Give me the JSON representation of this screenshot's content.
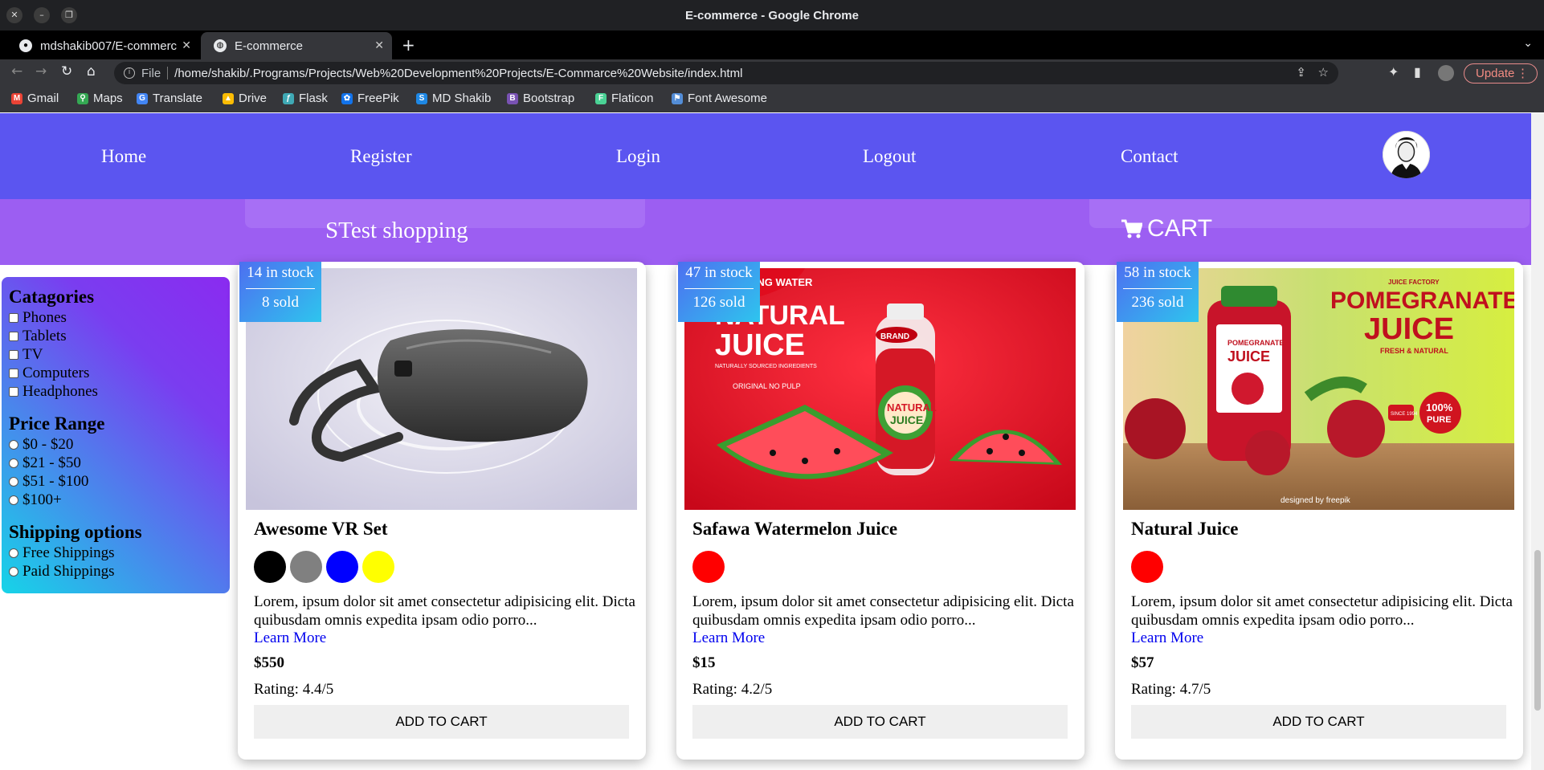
{
  "window": {
    "title": "E-commerce - Google Chrome"
  },
  "tabs": [
    {
      "label": "mdshakib007/E-commerce",
      "icon": "github-icon"
    },
    {
      "label": "E-commerce",
      "icon": "globe-icon"
    }
  ],
  "address": {
    "scheme": "File",
    "url": "/home/shakib/.Programs/Projects/Web%20Development%20Projects/E-Commarce%20Website/index.html"
  },
  "update_label": "Update",
  "bookmarks": [
    {
      "label": "Gmail",
      "icon": "gmail-icon",
      "color": "#ea4335"
    },
    {
      "label": "Maps",
      "icon": "maps-icon",
      "color": "#34a853"
    },
    {
      "label": "Translate",
      "icon": "translate-icon",
      "color": "#4285f4"
    },
    {
      "label": "Drive",
      "icon": "drive-icon",
      "color": "#fbbc04"
    },
    {
      "label": "Flask",
      "icon": "flask-icon",
      "color": "#3fa9b5"
    },
    {
      "label": "FreePik",
      "icon": "freepik-icon",
      "color": "#1273eb"
    },
    {
      "label": "MD Shakib",
      "icon": "site-icon",
      "color": "#1e88e5"
    },
    {
      "label": "Bootstrap",
      "icon": "bootstrap-icon",
      "color": "#7952b3"
    },
    {
      "label": "Flaticon",
      "icon": "flaticon-icon",
      "color": "#4ad295"
    },
    {
      "label": "Font Awesome",
      "icon": "fontawesome-icon",
      "color": "#538dd7"
    }
  ],
  "nav": {
    "home": "Home",
    "register": "Register",
    "login": "Login",
    "logout": "Logout",
    "contact": "Contact"
  },
  "shop": {
    "title": "STest shopping",
    "cart": "CART"
  },
  "filters": {
    "categories_title": "Catagories",
    "categories": [
      "Phones",
      "Tablets",
      "TV",
      "Computers",
      "Headphones"
    ],
    "price_title": "Price Range",
    "prices": [
      "$0 - $20",
      "$21 - $50",
      "$51 - $100",
      "$100+"
    ],
    "shipping_title": "Shipping options",
    "shipping": [
      "Free Shippings",
      "Paid Shippings"
    ]
  },
  "products": [
    {
      "stock": "14 in stock",
      "sold": "8 sold",
      "name": "Awesome VR Set",
      "colors": [
        "#000000",
        "#808080",
        "#0000ff",
        "#ffff00"
      ],
      "desc": "Lorem, ipsum dolor sit amet consectetur adipisicing elit. Dicta quibusdam omnis expedita ipsam odio porro...",
      "learn": "Learn More",
      "price": "$550",
      "rating": "Rating: 4.4/5",
      "button": "ADD TO CART"
    },
    {
      "stock": "47 in stock",
      "sold": "126 sold",
      "name": "Safawa Watermelon Juice",
      "colors": [
        "#ff0000"
      ],
      "desc": "Lorem, ipsum dolor sit amet consectetur adipisicing elit. Dicta quibusdam omnis expedita ipsam odio porro...",
      "learn": "Learn More",
      "price": "$15",
      "rating": "Rating: 4.2/5",
      "button": "ADD TO CART",
      "img": {
        "top": "SPRING WATER",
        "h1": "NATURAL",
        "h2": "JUICE",
        "sub": "NATURALLY SOURCED INGREDIENTS",
        "sub2": "ORIGINAL NO PULP",
        "label1": "NATURAL",
        "label2": "JUICE",
        "brand": "BRAND"
      }
    },
    {
      "stock": "58 in stock",
      "sold": "236 sold",
      "name": "Natural Juice",
      "colors": [
        "#ff0000"
      ],
      "desc": "Lorem, ipsum dolor sit amet consectetur adipisicing elit. Dicta quibusdam omnis expedita ipsam odio porro...",
      "learn": "Learn More",
      "price": "$57",
      "rating": "Rating: 4.7/5",
      "button": "ADD TO CART",
      "img": {
        "top": "JUICE FACTORY",
        "h1": "POMEGRANATE",
        "h2": "JUICE",
        "sub": "FRESH & NATURAL",
        "badge1": "100%",
        "badge2": "PURE",
        "since": "SINCE 1994",
        "label1": "POMEGRANATE",
        "label2": "JUICE",
        "credit": "designed by freepik"
      }
    }
  ]
}
